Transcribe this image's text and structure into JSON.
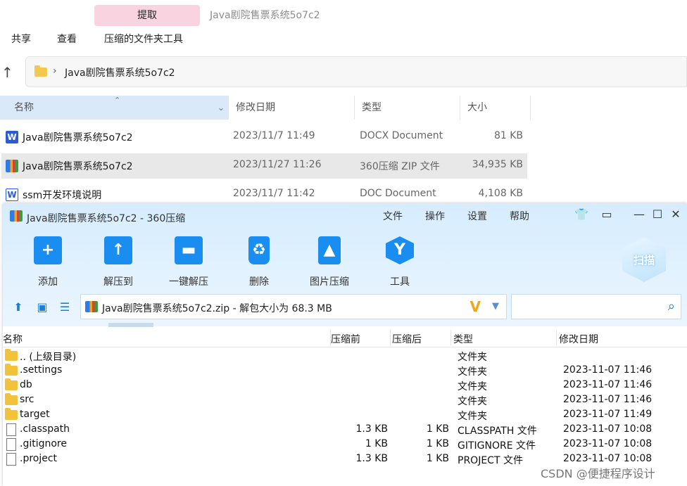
{
  "explorer": {
    "extract_tab": "提取",
    "window_title": "Java剧院售票系统5o7c2",
    "ribbon": [
      "共享",
      "查看",
      "压缩的文件夹工具"
    ],
    "address_path": "Java剧院售票系统5o7c2",
    "columns": {
      "name": "名称",
      "modified": "修改日期",
      "type": "类型",
      "size": "大小"
    },
    "files": [
      {
        "icon": "word-doc-icon",
        "name": "Java剧院售票系统5o7c2",
        "modified": "2023/11/7 11:49",
        "type": "DOCX Document",
        "size": "81 KB"
      },
      {
        "icon": "zip-archive-icon",
        "name": "Java剧院售票系统5o7c2",
        "modified": "2023/11/27 11:26",
        "type": "360压缩 ZIP 文件",
        "size": "34,935 KB"
      },
      {
        "icon": "word-doc-icon",
        "name": "ssm开发环境说明",
        "modified": "2023/11/7 11:42",
        "type": "DOC Document",
        "size": "4,108 KB"
      }
    ]
  },
  "zip": {
    "title": "Java剧院售票系统5o7c2 - 360压缩",
    "menu": [
      "文件",
      "操作",
      "设置",
      "帮助"
    ],
    "toolbar": [
      "添加",
      "解压到",
      "一键解压",
      "删除",
      "图片压缩",
      "工具"
    ],
    "scan_label": "扫描",
    "path_text": "Java剧院售票系统5o7c2.zip - 解包大小为 68.3 MB",
    "columns": {
      "name": "名称",
      "before": "压缩前",
      "after": "压缩后",
      "type": "类型",
      "modified": "修改日期"
    },
    "rows": [
      {
        "kind": "folder",
        "name": ".. (上级目录)",
        "before": "",
        "after": "",
        "type": "文件夹",
        "modified": ""
      },
      {
        "kind": "folder",
        "name": ".settings",
        "before": "",
        "after": "",
        "type": "文件夹",
        "modified": "2023-11-07 11:46"
      },
      {
        "kind": "folder",
        "name": "db",
        "before": "",
        "after": "",
        "type": "文件夹",
        "modified": "2023-11-07 11:46"
      },
      {
        "kind": "folder",
        "name": "src",
        "before": "",
        "after": "",
        "type": "文件夹",
        "modified": "2023-11-07 11:46"
      },
      {
        "kind": "folder",
        "name": "target",
        "before": "",
        "after": "",
        "type": "文件夹",
        "modified": "2023-11-07 11:49"
      },
      {
        "kind": "file",
        "name": ".classpath",
        "before": "1.3 KB",
        "after": "1 KB",
        "type": "CLASSPATH 文件",
        "modified": "2023-11-07 10:08"
      },
      {
        "kind": "file",
        "name": ".gitignore",
        "before": "1 KB",
        "after": "1 KB",
        "type": "GITIGNORE 文件",
        "modified": "2023-11-07 10:08"
      },
      {
        "kind": "file",
        "name": ".project",
        "before": "1.3 KB",
        "after": "1 KB",
        "type": "PROJECT 文件",
        "modified": "2023-11-07 10:08"
      }
    ]
  },
  "watermark": "CSDN @便捷程序设计"
}
